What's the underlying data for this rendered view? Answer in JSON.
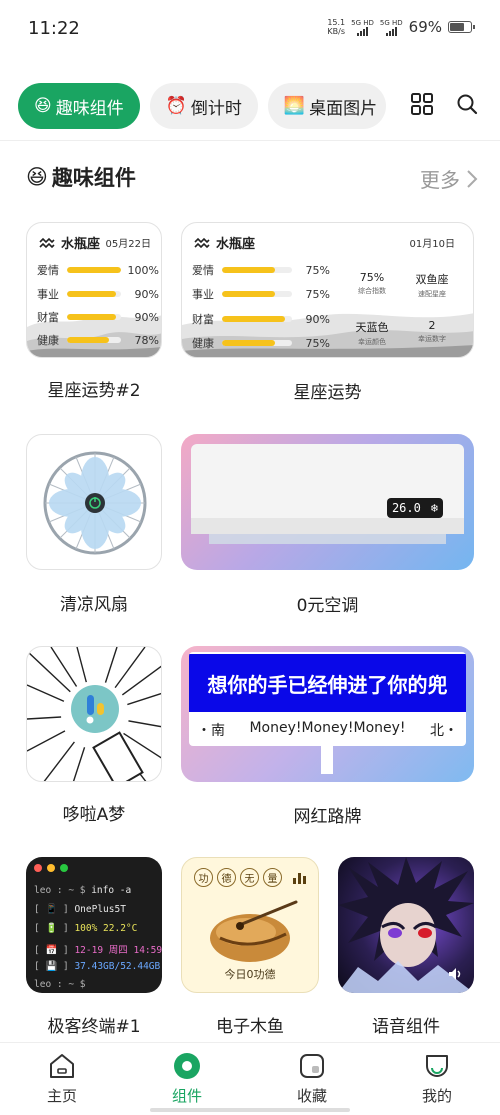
{
  "status": {
    "time": "11:22",
    "speed": "15.1",
    "speed_unit": "KB/s",
    "sim1": "5G HD",
    "sim2": "5G HD",
    "battery": "69%"
  },
  "tabs": [
    {
      "emoji": "😆",
      "label": "趣味组件"
    },
    {
      "emoji": "⏰",
      "label": "倒计时"
    },
    {
      "emoji": "🌅",
      "label": "桌面图片"
    }
  ],
  "section": {
    "emoji": "😆",
    "title": "趣味组件",
    "more": "更多"
  },
  "horoscope_small": {
    "sign": "水瓶座",
    "date": "05月22日",
    "rows": [
      {
        "label": "爱情",
        "value": "100%",
        "level": 1.0
      },
      {
        "label": "事业",
        "value": "90%",
        "level": 0.9
      },
      {
        "label": "财富",
        "value": "90%",
        "level": 0.9
      },
      {
        "label": "健康",
        "value": "78%",
        "level": 0.78
      }
    ],
    "caption": "星座运势#2"
  },
  "horoscope_large": {
    "sign": "水瓶座",
    "date": "01月10日",
    "rows": [
      {
        "label": "爱情",
        "value": "75%",
        "level": 0.75
      },
      {
        "label": "事业",
        "value": "75%",
        "level": 0.75
      },
      {
        "label": "财富",
        "value": "90%",
        "level": 0.9
      },
      {
        "label": "健康",
        "value": "75%",
        "level": 0.75
      }
    ],
    "stats": [
      {
        "value": "75%",
        "sub": "综合指数"
      },
      {
        "value": "双鱼座",
        "sub": "速配星座"
      },
      {
        "value": "天蓝色",
        "sub": "幸运颜色"
      },
      {
        "value": "2",
        "sub": "幸运数字"
      }
    ],
    "caption": "星座运势"
  },
  "fan": {
    "caption": "清凉风扇"
  },
  "aircon": {
    "temp": "26.0",
    "mode": "❄",
    "caption": "0元空调"
  },
  "doraemon": {
    "caption": "哆啦A梦"
  },
  "sign": {
    "banner": "想你的手已经伸进了你的兜",
    "left": "・南",
    "center": "Money!Money!Money!",
    "right": "北・",
    "caption": "网红路牌"
  },
  "terminal": {
    "lines": [
      {
        "prompt": "leo : ~ $",
        "text": " info -a",
        "color": "#e6e6e6"
      },
      {
        "prompt": "[ 📱 ]",
        "text": " OnePlus5T",
        "color": "#e6e6e6"
      },
      {
        "prompt": "[ 🔋 ]",
        "text": " 100% 22.2°C",
        "color": "#e8e25a"
      },
      {
        "prompt": "[ 📅 ]",
        "text": " 12-19 周四 14:59",
        "color": "#e86cc8"
      },
      {
        "prompt": "[ 💾 ]",
        "text": " 37.43GB/52.44GB",
        "color": "#6aa8ff"
      },
      {
        "prompt": "leo : ~ $",
        "text": "",
        "color": "#e6e6e6"
      }
    ],
    "caption": "极客终端#1"
  },
  "fish": {
    "virtues": [
      "功",
      "德",
      "无",
      "量"
    ],
    "merit": "今日0功德",
    "caption": "电子木鱼"
  },
  "voice": {
    "caption": "语音组件"
  },
  "nav": [
    {
      "label": "主页"
    },
    {
      "label": "组件"
    },
    {
      "label": "收藏"
    },
    {
      "label": "我的"
    }
  ],
  "colors": {
    "accent": "#1aa562",
    "bar": "#f6c21b",
    "terminal_bg": "#1c1c1c"
  }
}
